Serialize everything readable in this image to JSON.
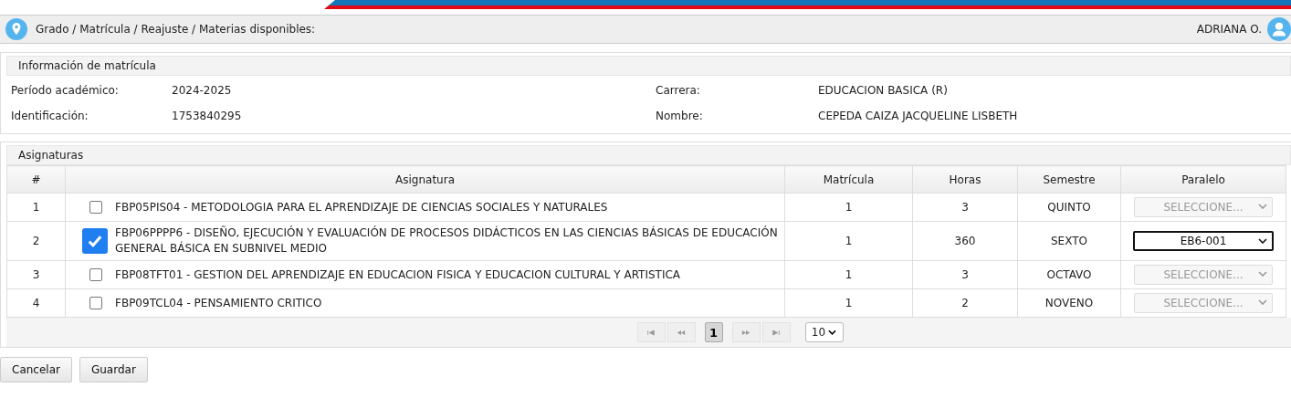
{
  "breadcrumb": "Grado / Matrícula / Reajuste / Materias disponibles:",
  "user": "ADRIANA O.",
  "info": {
    "title": "Información de matrícula",
    "fields": [
      {
        "label": "Período académico:",
        "value": "2024-2025"
      },
      {
        "label": "Carrera:",
        "value": "EDUCACION BASICA (R)"
      },
      {
        "label": "Identificación:",
        "value": "1753840295"
      },
      {
        "label": "Nombre:",
        "value": "CEPEDA CAIZA JACQUELINE LISBETH"
      }
    ]
  },
  "subjects": {
    "title": "Asignaturas",
    "columns": [
      "#",
      "Asignatura",
      "Matrícula",
      "Horas",
      "Semestre",
      "Paralelo"
    ],
    "rows": [
      {
        "number": "1",
        "checked": false,
        "name": "FBP05PIS04 - METODOLOGIA PARA EL APRENDIZAJE DE CIENCIAS SOCIALES Y NATURALES",
        "enrollment": "1",
        "hours": "3",
        "semester": "QUINTO",
        "parallel": {
          "disabled": true,
          "placeholder": "SELECCIONE..."
        }
      },
      {
        "number": "2",
        "checked": true,
        "name": "FBP06PPPP6 - DISEÑO, EJECUCIÓN Y EVALUACIÓN DE PROCESOS DIDÁCTICOS EN LAS CIENCIAS BÁSICAS DE EDUCACIÓN GENERAL BÁSICA EN SUBNIVEL MEDIO",
        "enrollment": "1",
        "hours": "360",
        "semester": "SEXTO",
        "parallel": {
          "disabled": false,
          "value": "EB6-001"
        }
      },
      {
        "number": "3",
        "checked": false,
        "name": "FBP08TFT01 - GESTION DEL APRENDIZAJE EN EDUCACION FISICA Y EDUCACION CULTURAL Y ARTISTICA",
        "enrollment": "1",
        "hours": "3",
        "semester": "OCTAVO",
        "parallel": {
          "disabled": true,
          "placeholder": "SELECCIONE..."
        }
      },
      {
        "number": "4",
        "checked": false,
        "name": "FBP09TCL04 - PENSAMIENTO CRITICO",
        "enrollment": "1",
        "hours": "2",
        "semester": "NOVENO",
        "parallel": {
          "disabled": true,
          "placeholder": "SELECCIONE..."
        }
      }
    ],
    "pager": {
      "pages": [
        {
          "label": "1",
          "selected": true
        }
      ],
      "page_size": "10"
    }
  },
  "buttons": [
    "Cancelar",
    "Guardar"
  ]
}
